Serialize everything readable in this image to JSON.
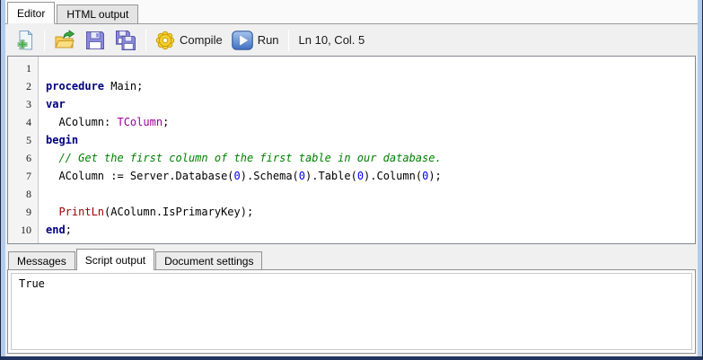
{
  "colors": {
    "window_border": "#20325e",
    "window_edge_blue": "#b3cceb",
    "toolbar_bg": "#f0f0f0",
    "keyword": "#000080",
    "type_name": "#990099",
    "number": "#0000ee",
    "comment": "#008000",
    "magic_function": "#990000",
    "gear_yellow": "#f5d02c",
    "run_blue": "#4a7cd0",
    "folder_yellow": "#f7cf5a",
    "floppy_purple": "#8a8ade",
    "plus_green": "#45b04d"
  },
  "top_tabs": [
    {
      "label": "Editor",
      "active": true
    },
    {
      "label": "HTML output",
      "active": false
    }
  ],
  "toolbar": {
    "buttons": [
      {
        "name": "new-file-button",
        "icon": "new-file-icon",
        "label": ""
      },
      {
        "name": "open-button",
        "icon": "open-folder-icon",
        "label": ""
      },
      {
        "name": "save-button",
        "icon": "save-icon",
        "label": ""
      },
      {
        "name": "save-all-button",
        "icon": "save-all-icon",
        "label": ""
      },
      {
        "name": "compile-button",
        "icon": "gear-icon",
        "label": "Compile"
      },
      {
        "name": "run-button",
        "icon": "play-icon",
        "label": "Run"
      }
    ],
    "compile_label": "Compile",
    "run_label": "Run",
    "caret_position": "Ln 10, Col. 5"
  },
  "editor": {
    "line_numbers": [
      "1",
      "2",
      "3",
      "4",
      "5",
      "6",
      "7",
      "8",
      "9",
      "10"
    ],
    "lines": [
      [],
      [
        {
          "t": "kw",
          "s": "procedure"
        },
        {
          "t": "plain",
          "s": " Main;"
        }
      ],
      [
        {
          "t": "kw",
          "s": "var"
        }
      ],
      [
        {
          "t": "plain",
          "s": "  AColumn: "
        },
        {
          "t": "type",
          "s": "TColumn"
        },
        {
          "t": "plain",
          "s": ";"
        }
      ],
      [
        {
          "t": "kw",
          "s": "begin"
        }
      ],
      [
        {
          "t": "comment",
          "s": "  // Get the first column of the first table in our database."
        }
      ],
      [
        {
          "t": "plain",
          "s": "  AColumn := Server.Database("
        },
        {
          "t": "num",
          "s": "0"
        },
        {
          "t": "plain",
          "s": ").Schema("
        },
        {
          "t": "num",
          "s": "0"
        },
        {
          "t": "plain",
          "s": ").Table("
        },
        {
          "t": "num",
          "s": "0"
        },
        {
          "t": "plain",
          "s": ").Column("
        },
        {
          "t": "num",
          "s": "0"
        },
        {
          "t": "plain",
          "s": ");"
        }
      ],
      [],
      [
        {
          "t": "plain",
          "s": "  "
        },
        {
          "t": "magic",
          "s": "PrintLn"
        },
        {
          "t": "plain",
          "s": "(AColumn.IsPrimaryKey);"
        }
      ],
      [
        {
          "t": "kw",
          "s": "end"
        },
        {
          "t": "plain",
          "s": ";"
        }
      ]
    ]
  },
  "bottom_tabs": [
    {
      "label": "Messages",
      "active": false
    },
    {
      "label": "Script output",
      "active": true
    },
    {
      "label": "Document settings",
      "active": false
    }
  ],
  "output": {
    "text": "True"
  }
}
